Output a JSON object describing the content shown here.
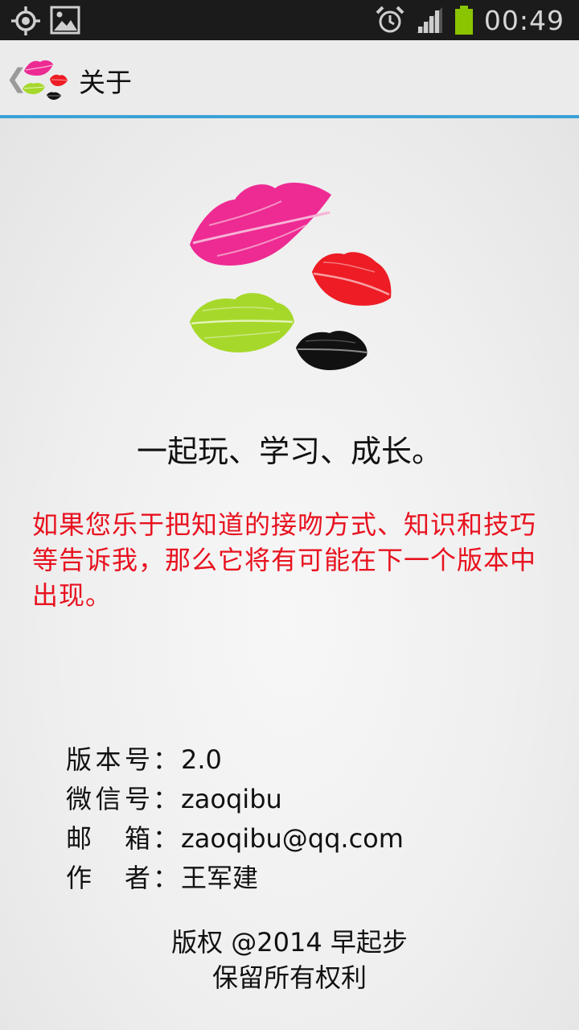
{
  "status_bar": {
    "time": "00:49",
    "icons": [
      "gps-icon",
      "image-icon",
      "alarm-icon",
      "signal-icon",
      "battery-icon"
    ],
    "battery_color": "#8bc400"
  },
  "action_bar": {
    "title": "关于",
    "accent": "#3aa3d6"
  },
  "about": {
    "slogan": "一起玩、学习、成长。",
    "invite": "如果您乐于把知道的接吻方式、知识和技巧等告诉我，那么它将有可能在下一个版本中出现。",
    "invite_color": "#e8121f",
    "info": [
      {
        "label": "版本号",
        "value": "2.0"
      },
      {
        "label": "微信号",
        "value": "zaoqibu"
      },
      {
        "label": "邮箱",
        "value": "zaoqibu@qq.com"
      },
      {
        "label": "作者",
        "value": "王军建"
      }
    ],
    "separator": "：",
    "copyright_line1": "版权 @2014 早起步",
    "copyright_line2": "保留所有权利"
  },
  "logo": {
    "lip_colors": [
      "#ee2a93",
      "#ee1c24",
      "#a6d82b",
      "#111111"
    ]
  }
}
